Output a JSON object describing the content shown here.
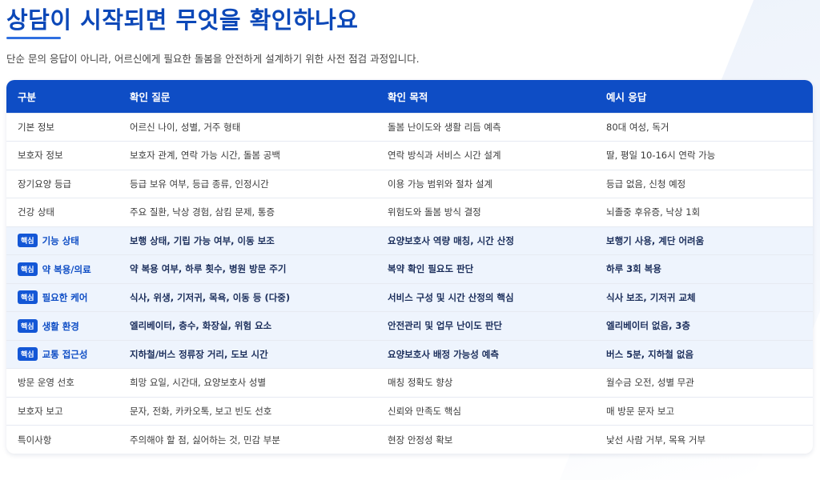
{
  "page": {
    "title": "상담이 시작되면 무엇을 확인하나요",
    "subtitle": "단순 문의 응답이 아니라, 어르신에게 필요한 돌봄을 안전하게 설계하기 위한 사전 점검 과정입니다."
  },
  "colors": {
    "accent": "#0e4dc5",
    "core_row_bg": "#eef4fd"
  },
  "table": {
    "headers": [
      "구분",
      "확인 질문",
      "확인 목적",
      "예시 응답"
    ],
    "badge_label": "핵심",
    "rows": [
      {
        "core": false,
        "category": "기본 정보",
        "question": "어르신 나이, 성별, 거주 형태",
        "purpose": "돌봄 난이도와 생활 리듬 예측",
        "example": "80대 여성, 독거"
      },
      {
        "core": false,
        "category": "보호자 정보",
        "question": "보호자 관계, 연락 가능 시간, 돌봄 공백",
        "purpose": "연락 방식과 서비스 시간 설계",
        "example": "딸, 평일 10-16시 연락 가능"
      },
      {
        "core": false,
        "category": "장기요양 등급",
        "question": "등급 보유 여부, 등급 종류, 인정시간",
        "purpose": "이용 가능 범위와 절차 설계",
        "example": "등급 없음, 신청 예정"
      },
      {
        "core": false,
        "category": "건강 상태",
        "question": "주요 질환, 낙상 경험, 삼킴 문제, 통증",
        "purpose": "위험도와 돌봄 방식 결정",
        "example": "뇌졸중 후유증, 낙상 1회"
      },
      {
        "core": true,
        "category": "기능 상태",
        "question": "보행 상태, 기립 가능 여부, 이동 보조",
        "purpose": "요양보호사 역량 매칭, 시간 산정",
        "example": "보행기 사용, 계단 어려움"
      },
      {
        "core": true,
        "category": "약 복용/의료",
        "question": "약 복용 여부, 하루 횟수, 병원 방문 주기",
        "purpose": "복약 확인 필요도 판단",
        "example": "하루 3회 복용"
      },
      {
        "core": true,
        "category": "필요한 케어",
        "question": "식사, 위생, 기저귀, 목욕, 이동 등 (다중)",
        "purpose": "서비스 구성 및 시간 산정의 핵심",
        "example": "식사 보조, 기저귀 교체"
      },
      {
        "core": true,
        "category": "생활 환경",
        "question": "엘리베이터, 층수, 화장실, 위험 요소",
        "purpose": "안전관리 및 업무 난이도 판단",
        "example": "엘리베이터 없음, 3층"
      },
      {
        "core": true,
        "category": "교통 접근성",
        "question": "지하철/버스 정류장 거리, 도보 시간",
        "purpose": "요양보호사 배정 가능성 예측",
        "example": "버스 5분, 지하철 없음"
      },
      {
        "core": false,
        "category": "방문 운영 선호",
        "question": "희망 요일, 시간대, 요양보호사 성별",
        "purpose": "매칭 정확도 향상",
        "example": "월수금 오전, 성별 무관"
      },
      {
        "core": false,
        "category": "보호자 보고",
        "question": "문자, 전화, 카카오톡, 보고 빈도 선호",
        "purpose": "신뢰와 만족도 핵심",
        "example": "매 방문 문자 보고"
      },
      {
        "core": false,
        "category": "특이사항",
        "question": "주의해야 할 점, 싫어하는 것, 민감 부분",
        "purpose": "현장 안정성 확보",
        "example": "낯선 사람 거부, 목욕 거부"
      }
    ]
  }
}
